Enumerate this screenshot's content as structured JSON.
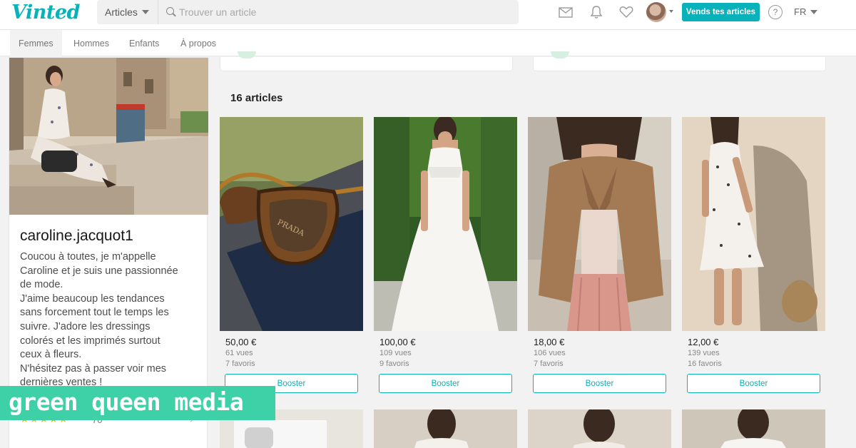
{
  "header": {
    "logo": "Vinted",
    "search_category": "Articles",
    "search_placeholder": "Trouver un article",
    "sell_button": "Vends tes articles",
    "help": "?",
    "language": "FR"
  },
  "nav": {
    "categories": [
      "Femmes",
      "Hommes",
      "Enfants",
      "À propos"
    ],
    "active": "Femmes"
  },
  "profile": {
    "username": "caroline.jacquot1",
    "bio_lines": [
      "Coucou à toutes, je m'appelle",
      "Caroline et je suis une passionnée",
      "de mode.",
      "J'aime beaucoup les tendances",
      "sans forcement tout le temps les",
      "suivre. J'adore les dressings",
      "colorés et les imprimés surtout",
      "ceux à fleurs.",
      "N'hésitez pas à passer voir mes",
      "dernières ventes !"
    ],
    "stars": "★★★★★",
    "rating_count": "70"
  },
  "listing": {
    "count_label": "16 articles",
    "items": [
      {
        "price": "50,00 €",
        "views": "61 vues",
        "favorites": "7 favoris",
        "boost": "Booster"
      },
      {
        "price": "100,00 €",
        "views": "109 vues",
        "favorites": "9 favoris",
        "boost": "Booster"
      },
      {
        "price": "18,00 €",
        "views": "106 vues",
        "favorites": "7 favoris",
        "boost": "Booster"
      },
      {
        "price": "12,00 €",
        "views": "139 vues",
        "favorites": "16 favoris",
        "boost": "Booster"
      }
    ]
  },
  "watermark": "green queen media",
  "colors": {
    "accent": "#09b1ba",
    "watermark": "#3ed0a6",
    "stars": "#f5b400"
  }
}
